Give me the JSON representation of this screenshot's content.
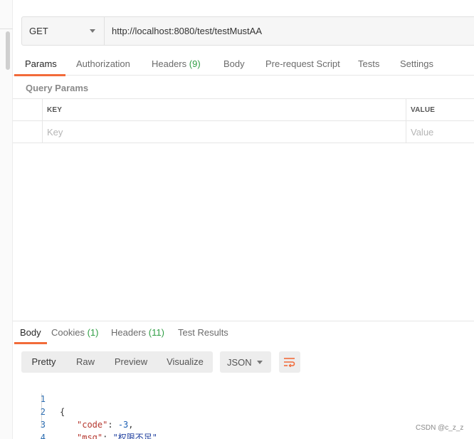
{
  "request": {
    "method": "GET",
    "url": "http://localhost:8080/test/testMustAA"
  },
  "request_tabs": {
    "params": "Params",
    "authorization": "Authorization",
    "headers": "Headers",
    "headers_count": "(9)",
    "body": "Body",
    "prerequest": "Pre-request Script",
    "tests": "Tests",
    "settings": "Settings"
  },
  "query_params": {
    "title": "Query Params",
    "key_header": "KEY",
    "value_header": "VALUE",
    "key_placeholder": "Key",
    "value_placeholder": "Value"
  },
  "response_tabs": {
    "body": "Body",
    "cookies": "Cookies",
    "cookies_count": "(1)",
    "headers": "Headers",
    "headers_count": "(11)",
    "test_results": "Test Results"
  },
  "view_modes": {
    "pretty": "Pretty",
    "raw": "Raw",
    "preview": "Preview",
    "visualize": "Visualize",
    "format": "JSON",
    "wrap_icon": "wrap-lines-icon"
  },
  "response_body": {
    "line_numbers": [
      "1",
      "2",
      "3",
      "4"
    ],
    "open_brace": "{",
    "close_brace": "}",
    "code_key": "\"code\"",
    "code_value": "-3",
    "msg_key": "\"msg\"",
    "msg_value": "\"权限不足\""
  },
  "watermark": "CSDN @c_z_z",
  "colors": {
    "accent": "#f26b3a",
    "count_green": "#2f9e44"
  }
}
